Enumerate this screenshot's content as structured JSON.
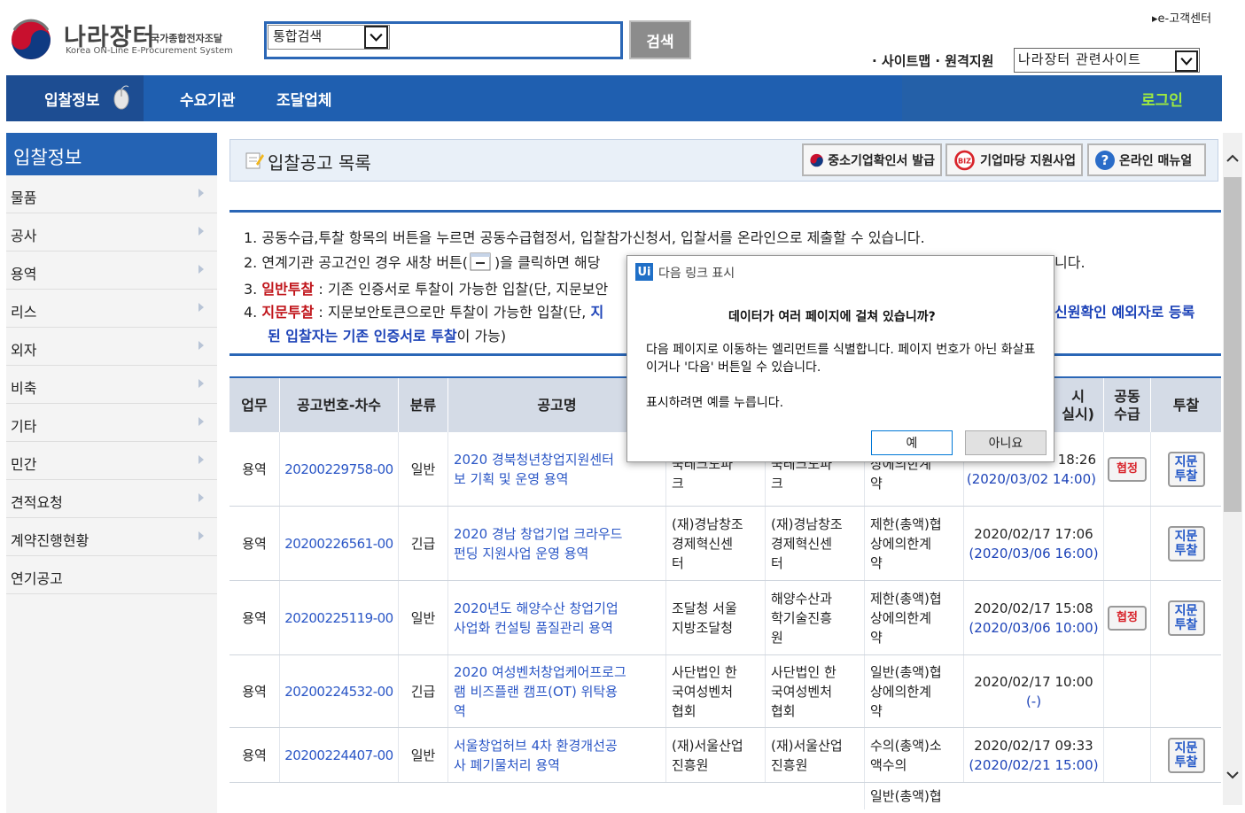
{
  "header": {
    "logo_title": "나라장터",
    "logo_sub": "국가종합전자조달",
    "logo_en": "Korea ON-Line E-Procurement System",
    "search_select": "통합검색",
    "search_button": "검색",
    "customer_center": "▸e-고객센터",
    "util_links": "· 사이트맵 · 원격지원",
    "related_select": "나라장터 관련사이트"
  },
  "nav": {
    "items": [
      "입찰정보",
      "수요기관",
      "조달업체"
    ],
    "login": "로그인"
  },
  "sidebar": {
    "title": "입찰정보",
    "items": [
      "물품",
      "공사",
      "용역",
      "리스",
      "외자",
      "비축",
      "기타",
      "민간",
      "견적요청",
      "계약진행현황",
      "연기공고"
    ]
  },
  "main": {
    "title": "입찰공고 목록",
    "buttons": [
      "중소기업확인서 발급",
      "기업마당 지원사업",
      "온라인 매뉴얼"
    ]
  },
  "notice": {
    "l1": "1.  공동수급,투찰 항목의 버튼을 누르면 공동수급협정서, 입찰참가신청서, 입찰서를 온라인으로 제출할 수 있습니다.",
    "l2a": "2.  연계기관 공고건인 경우 새창 버튼(",
    "l2b": ")을 클릭하면 해당",
    "l2c": "니다.",
    "l3num": "3.  ",
    "l3red": "일반투찰",
    "l3rest": " : 기존 인증서로 투찰이 가능한 입찰(단, 지문보안",
    "l4num": "4.  ",
    "l4red": "지문투찰",
    "l4rest": " : 지문보안토큰으로만 투찰이 가능한 입찰(단, ",
    "l4blue1": "지",
    "l4blue2": "신원확인 예외자로 등록",
    "l5blue": "된 입찰자는 기존 인증서로 투찰",
    "l5rest": "이 가능)"
  },
  "table": {
    "headers": [
      "업무",
      "공고번호-차수",
      "분류",
      "공고명",
      "시\n실시)",
      "공동\n수급",
      "투찰"
    ],
    "rows": [
      {
        "work": "용역",
        "no": "20200229758-00",
        "cls": "일반",
        "title1": "2020 경북청년창업지원센터",
        "title2": "보 기획 및 운영 용역",
        "org1": "국테크노파",
        "org2": "크",
        "dem1": "국테크노파",
        "dem2": "크",
        "ct1": "상에의한계",
        "ct2": "약",
        "date1": "18:26",
        "date2": "(2020/03/02 14:00)",
        "joint": "협정",
        "bid": "지문\n투찰"
      },
      {
        "work": "용역",
        "no": "20200226561-00",
        "cls": "긴급",
        "title1": "2020 경남 창업기업 크라우드",
        "title2": "펀딩 지원사업 운영 용역",
        "org1": "(재)경남창조",
        "org2": "경제혁신센",
        "org3": "터",
        "dem1": "(재)경남창조",
        "dem2": "경제혁신센",
        "dem3": "터",
        "ct1": "제한(총액)협",
        "ct2": "상에의한계",
        "ct3": "약",
        "date1": "2020/02/17 17:06",
        "date2": "(2020/03/06 16:00)",
        "joint": "",
        "bid": "지문\n투찰"
      },
      {
        "work": "용역",
        "no": "20200225119-00",
        "cls": "일반",
        "title1": "2020년도 해양수산 창업기업",
        "title2": "사업화 컨설팅 품질관리 용역",
        "org1": "조달청 서울",
        "org2": "지방조달청",
        "dem1": "해양수산과",
        "dem2": "학기술진흥",
        "dem3": "원",
        "ct1": "제한(총액)협",
        "ct2": "상에의한계",
        "ct3": "약",
        "date1": "2020/02/17 15:08",
        "date2": "(2020/03/06 10:00)",
        "joint": "협정",
        "bid": "지문\n투찰"
      },
      {
        "work": "용역",
        "no": "20200224532-00",
        "cls": "긴급",
        "title1": "2020 여성벤처창업케어프로그",
        "title2": "램 비즈플랜 캠프(OT) 위탁용",
        "title3": "역",
        "org1": "사단법인 한",
        "org2": "국여성벤처",
        "org3": "협회",
        "dem1": "사단법인 한",
        "dem2": "국여성벤처",
        "dem3": "협회",
        "ct1": "일반(총액)협",
        "ct2": "상에의한계",
        "ct3": "약",
        "date1": "2020/02/17 10:00",
        "date2": "(-)",
        "joint": "",
        "bid": ""
      },
      {
        "work": "용역",
        "no": "20200224407-00",
        "cls": "일반",
        "title1": "서울창업허브 4차 환경개선공",
        "title2": "사 폐기물처리 용역",
        "org1": "(재)서울산업",
        "org2": "진흥원",
        "dem1": "(재)서울산업",
        "dem2": "진흥원",
        "ct1": "수의(총액)소",
        "ct2": "액수의",
        "date1": "2020/02/17 09:33",
        "date2": "(2020/02/21 15:00)",
        "joint": "",
        "bid": "지문\n투찰"
      }
    ],
    "partial_row_ct": "일반(총액)협"
  },
  "dialog": {
    "title": "다음 링크 표시",
    "icon": "Ui",
    "question": "데이터가 여러 페이지에 걸쳐 있습니까?",
    "body": "다음 페이지로 이동하는 엘리먼트를 식별합니다. 페이지 번호가 아닌 화살표이거나 '다음' 버튼일 수 있습니다.",
    "body2": "표시하려면 예를 누릅니다.",
    "yes": "예",
    "no": "아니요"
  },
  "colors": {
    "nav_blue": "#1f5fb0",
    "login_green": "#9eea3f",
    "link_blue": "#2a56c6",
    "alert_red": "#c0141a"
  }
}
